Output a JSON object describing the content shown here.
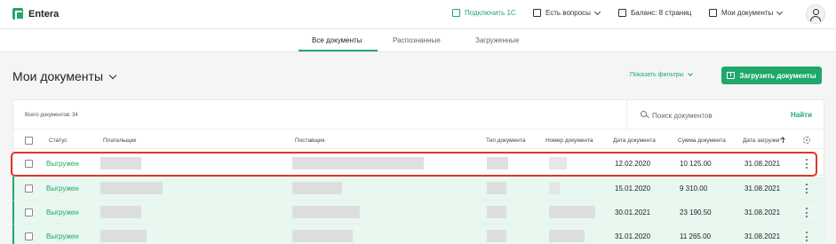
{
  "app": {
    "name": "Entera"
  },
  "topbar": {
    "connect_1c": "Подключить 1С",
    "questions": "Есть вопросы",
    "balance": "Баланс: 8 страниц",
    "my_docs": "Мои документы"
  },
  "tabs": [
    "Все документы",
    "Распознанные",
    "Загруженные"
  ],
  "page": {
    "title": "Мои документы",
    "show_filters": "Показать фильтры",
    "upload_button": "Загрузить документы"
  },
  "table": {
    "total": "Всего документов: 34",
    "search_placeholder": "Поиск документов",
    "find_label": "Найти",
    "columns": {
      "status": "Статус",
      "payer": "Плательщик",
      "supplier": "Поставщик",
      "doc_type": "Тип документа",
      "doc_number": "Номер документа",
      "doc_date": "Дата документа",
      "sum": "Сумма документа",
      "upload_date": "Дата загрузки"
    },
    "rows": [
      {
        "status": "Выгружен",
        "date": "12.02.2020",
        "sum": "10 125.00",
        "uploaded": "31.08.2021"
      },
      {
        "status": "Выгружен",
        "date": "15.01.2020",
        "sum": "9 310.00",
        "uploaded": "31.08.2021"
      },
      {
        "status": "Выгружен",
        "date": "30.01.2021",
        "sum": "23 190.50",
        "uploaded": "31.08.2021"
      },
      {
        "status": "Выгружен",
        "date": "31.01.2020",
        "sum": "11 265.00",
        "uploaded": "31.08.2021"
      }
    ]
  },
  "colors": {
    "accent": "#1fa86a",
    "highlight_border": "#e0352b",
    "row_highlight": "#e8f7ef"
  }
}
